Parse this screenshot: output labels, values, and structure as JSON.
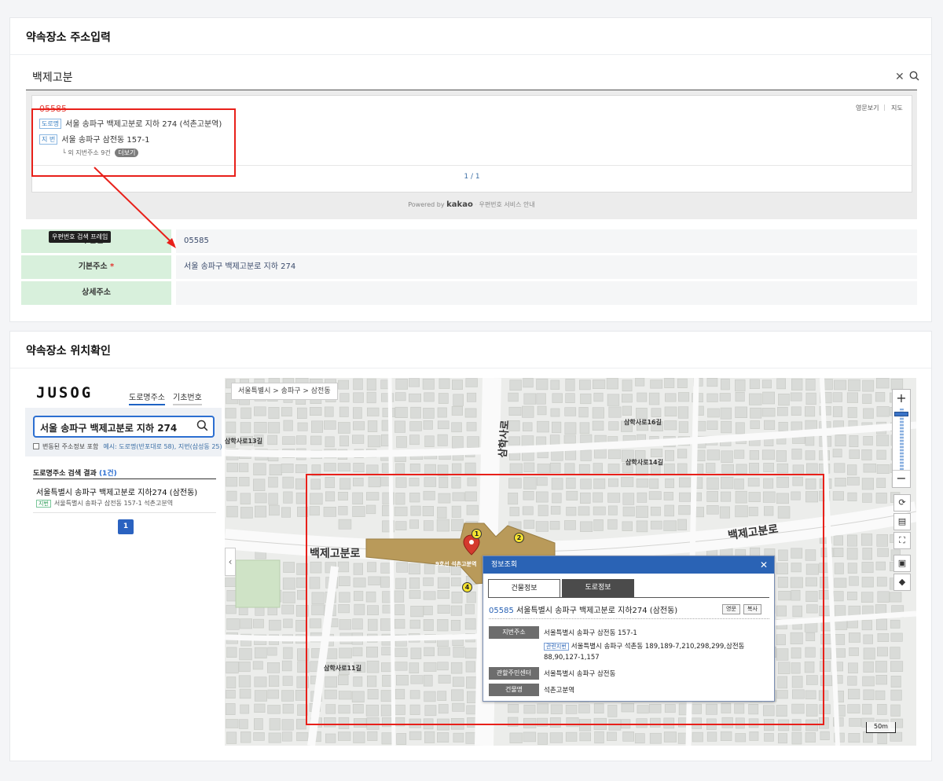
{
  "section1": {
    "title": "약속장소 주소입력",
    "search_value": "백제고분",
    "kakao": {
      "result_zip": "05585",
      "road_tag": "도로명",
      "road_address": "서울 송파구 백제고분로 지하 274 (석촌고분역)",
      "jibun_tag": "지 번",
      "jibun_address": "서울 송파구 삼전동 157-1",
      "more_text": "└ 외 지번주소 9건",
      "more_button": "더보기",
      "link_english": "영문보기",
      "link_map": "지도",
      "pager_current": "1",
      "pager_total": "/ 1",
      "footer_powered": "Powered by",
      "footer_brand": "kakao",
      "footer_guide": "우편번호 서비스 안내"
    },
    "tooltip": "우편번호 검색 프레임",
    "rows": [
      {
        "label": "우편번호",
        "value": "05585",
        "required": ""
      },
      {
        "label": "기본주소",
        "value": "서울 송파구 백제고분로 지하 274",
        "required": "*"
      },
      {
        "label": "상세주소",
        "value": "",
        "required": ""
      }
    ]
  },
  "section2": {
    "title": "약속장소 위치확인",
    "jusog": {
      "logo": "JUSOG",
      "tab_road": "도로명주소",
      "tab_basic": "기초번호",
      "search_value": "서울 송파구 백제고분로 지하 274",
      "checkbox_label": "변동된 주소정보 포함",
      "example": "예시: 도로명(반포대로 58), 지번(삼성동 25)",
      "result_title": "도로명주소 검색 결과",
      "result_count": "(1건)",
      "result_main": "서울특별시 송파구 백제고분로 지하274 (삼전동)",
      "result_jibun_tag": "지번",
      "result_jibun": "서울특별시 송파구 삼전동 157-1 석촌고분역",
      "page": "1"
    },
    "map": {
      "breadcrumb": "서울특별시 > 송파구 > 삼전동",
      "road_labels": [
        "백제고분로",
        "백제고분로",
        "삼학사로",
        "삼학사로11길",
        "삼학사로14길",
        "삼학사로16길",
        "삼학사로13길"
      ],
      "station_label": "9호선  석촌고분역",
      "exits": [
        "1",
        "2",
        "4"
      ],
      "scale": "50m",
      "zoom_in": "+",
      "zoom_out": "−",
      "info": {
        "header": "정보조회",
        "close": "✕",
        "tab_building": "건물정보",
        "tab_road": "도로정보",
        "zip": "05585",
        "address": "서울특별시 송파구 백제고분로 지하274 (삼전동)",
        "btn_english": "영문",
        "btn_copy": "복사",
        "jibun_label": "지번주소",
        "jibun_value": "서울특별시 송파구 삼전동 157-1",
        "related_tag": "관련지번",
        "related_value": "서울특별시 송파구 석촌동 189,189-7,210,298,299,삼전동",
        "related_value2": "88,90,127-1,157",
        "center_label": "관할주민센터",
        "center_value": "서울특별시 송파구 삼전동",
        "bldg_label": "건물명",
        "bldg_value": "석촌고분역"
      }
    }
  },
  "colors": {
    "accent_blue": "#2a63b5",
    "label_green": "#d8f0dc",
    "highlight_red": "#e8201a",
    "station_gold": "#b99a5a"
  }
}
